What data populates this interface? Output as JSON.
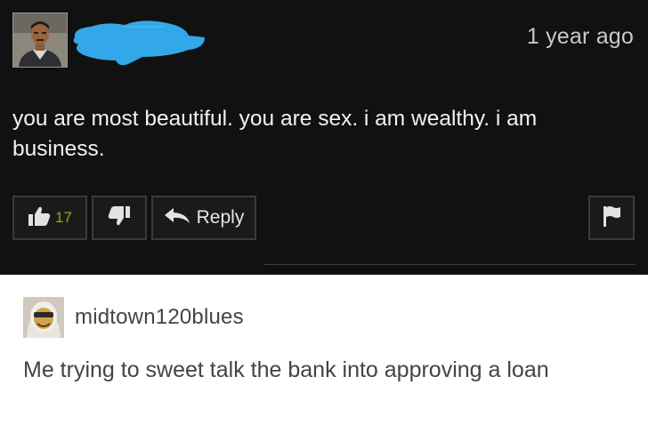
{
  "comment": {
    "timestamp": "1 year ago",
    "text": "you are most beautiful. you are sex. i am wealthy. i am business.",
    "like_count": "17",
    "reply_label": "Reply"
  },
  "post": {
    "username": "midtown120blues",
    "text": "Me trying to sweet talk the bank into approving a loan"
  },
  "colors": {
    "dark_background": "#111111",
    "redaction": "#32a8e8",
    "like_count": "#8ea61c",
    "post_text": "#444444"
  },
  "icons": [
    "thumbs-up-icon",
    "thumbs-down-icon",
    "reply-arrow-icon",
    "flag-icon"
  ]
}
